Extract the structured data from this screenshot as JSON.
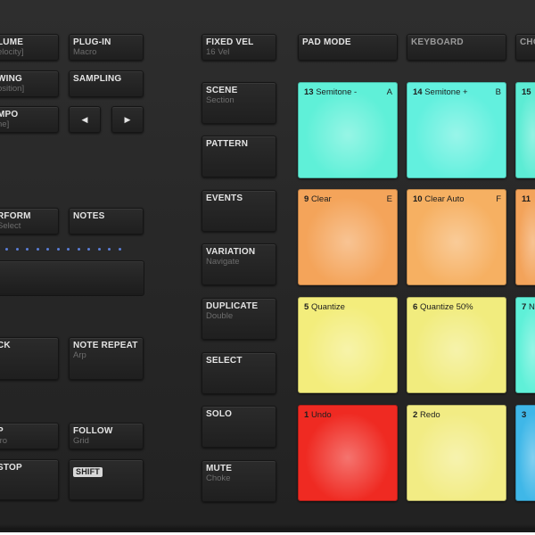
{
  "left_col1": [
    {
      "id": "volume",
      "label": "LUME",
      "sub": "elocity]"
    },
    {
      "id": "swing",
      "label": "WING",
      "sub": "osition]"
    },
    {
      "id": "tempo",
      "label": "MPO",
      "sub": "ne]"
    },
    {
      "id": "perform",
      "label": "RFORM",
      "sub": "Select"
    },
    {
      "id": "lock",
      "label": "CK",
      "sub": ""
    },
    {
      "id": "step",
      "label": "P",
      "sub": "tro"
    },
    {
      "id": "stop",
      "label": "STOP",
      "sub": ""
    }
  ],
  "left_col2": [
    {
      "id": "plugin",
      "label": "PLUG-IN",
      "sub": "Macro"
    },
    {
      "id": "sampling",
      "label": "SAMPLING",
      "sub": ""
    },
    {
      "id": "notes",
      "label": "NOTES",
      "sub": ""
    },
    {
      "id": "note_repeat",
      "label": "NOTE REPEAT",
      "sub": "Arp"
    },
    {
      "id": "follow",
      "label": "FOLLOW",
      "sub": "Grid"
    },
    {
      "id": "shift",
      "label": "SHIFT",
      "sub": ""
    }
  ],
  "arrows": {
    "left": "◀",
    "right": "▶"
  },
  "mid_col": [
    {
      "id": "fixed_vel",
      "label": "FIXED VEL",
      "sub": "16 Vel"
    },
    {
      "id": "scene",
      "label": "SCENE",
      "sub": "Section"
    },
    {
      "id": "pattern",
      "label": "PATTERN",
      "sub": ""
    },
    {
      "id": "events",
      "label": "EVENTS",
      "sub": ""
    },
    {
      "id": "variation",
      "label": "VARIATION",
      "sub": "Navigate"
    },
    {
      "id": "duplicate",
      "label": "DUPLICATE",
      "sub": "Double"
    },
    {
      "id": "select",
      "label": "SELECT",
      "sub": ""
    },
    {
      "id": "solo",
      "label": "SOLO",
      "sub": ""
    },
    {
      "id": "mute",
      "label": "MUTE",
      "sub": "Choke"
    }
  ],
  "top_row": [
    {
      "id": "pad_mode",
      "label": "PAD MODE"
    },
    {
      "id": "keyboard",
      "label": "KEYBOARD"
    },
    {
      "id": "chords",
      "label": "CHO"
    }
  ],
  "pads": [
    {
      "id": "13",
      "num": "13",
      "text": "Semitone -",
      "key": "A",
      "color": "#5ff0d8"
    },
    {
      "id": "14",
      "num": "14",
      "text": "Semitone +",
      "key": "B",
      "color": "#62f0de"
    },
    {
      "id": "15",
      "num": "15",
      "text": "",
      "key": "",
      "color": "#5cecd4"
    },
    {
      "id": "9",
      "num": "9",
      "text": "Clear",
      "key": "E",
      "color": "#f4a45a"
    },
    {
      "id": "10",
      "num": "10",
      "text": "Clear Auto",
      "key": "F",
      "color": "#f6b062"
    },
    {
      "id": "11",
      "num": "11",
      "text": "",
      "key": "",
      "color": "#f3a35a"
    },
    {
      "id": "5",
      "num": "5",
      "text": "Quantize",
      "key": "",
      "color": "#f3ed7c"
    },
    {
      "id": "6",
      "num": "6",
      "text": "Quantize 50%",
      "key": "",
      "color": "#f1ec7e"
    },
    {
      "id": "7",
      "num": "7",
      "text": "N",
      "key": "",
      "color": "#5ff0d8"
    },
    {
      "id": "1",
      "num": "1",
      "text": "Undo",
      "key": "",
      "color": "#ef2a22"
    },
    {
      "id": "2",
      "num": "2",
      "text": "Redo",
      "key": "",
      "color": "#f2ec84"
    },
    {
      "id": "3",
      "num": "3",
      "text": "",
      "key": "",
      "color": "#3fb7e8"
    }
  ]
}
